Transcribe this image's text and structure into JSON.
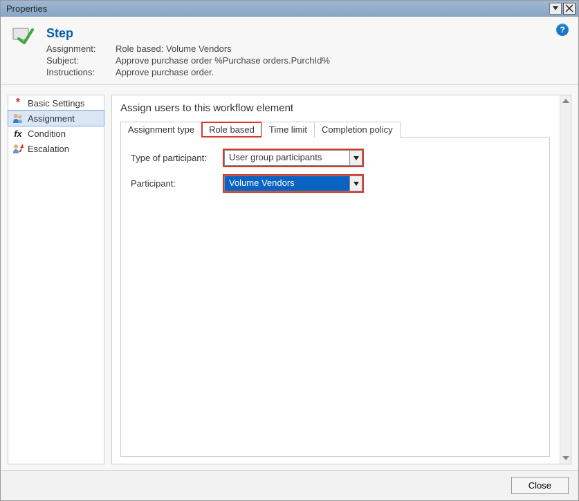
{
  "window": {
    "title": "Properties"
  },
  "header": {
    "step_title": "Step",
    "rows": {
      "assignment": {
        "label": "Assignment:",
        "value": "Role based: Volume Vendors"
      },
      "subject": {
        "label": "Subject:",
        "value": "Approve purchase order %Purchase orders.PurchId%"
      },
      "instructions": {
        "label": "Instructions:",
        "value": "Approve purchase order."
      }
    }
  },
  "sidebar": {
    "items": [
      {
        "label": "Basic Settings"
      },
      {
        "label": "Assignment"
      },
      {
        "label": "Condition"
      },
      {
        "label": "Escalation"
      }
    ]
  },
  "main": {
    "heading": "Assign users to this workflow element",
    "tabs": [
      {
        "label": "Assignment type"
      },
      {
        "label": "Role based"
      },
      {
        "label": "Time limit"
      },
      {
        "label": "Completion policy"
      }
    ],
    "form": {
      "type_of_participant": {
        "label": "Type of participant:",
        "value": "User group participants"
      },
      "participant": {
        "label": "Participant:",
        "value": "Volume Vendors"
      }
    }
  },
  "footer": {
    "close_label": "Close"
  }
}
